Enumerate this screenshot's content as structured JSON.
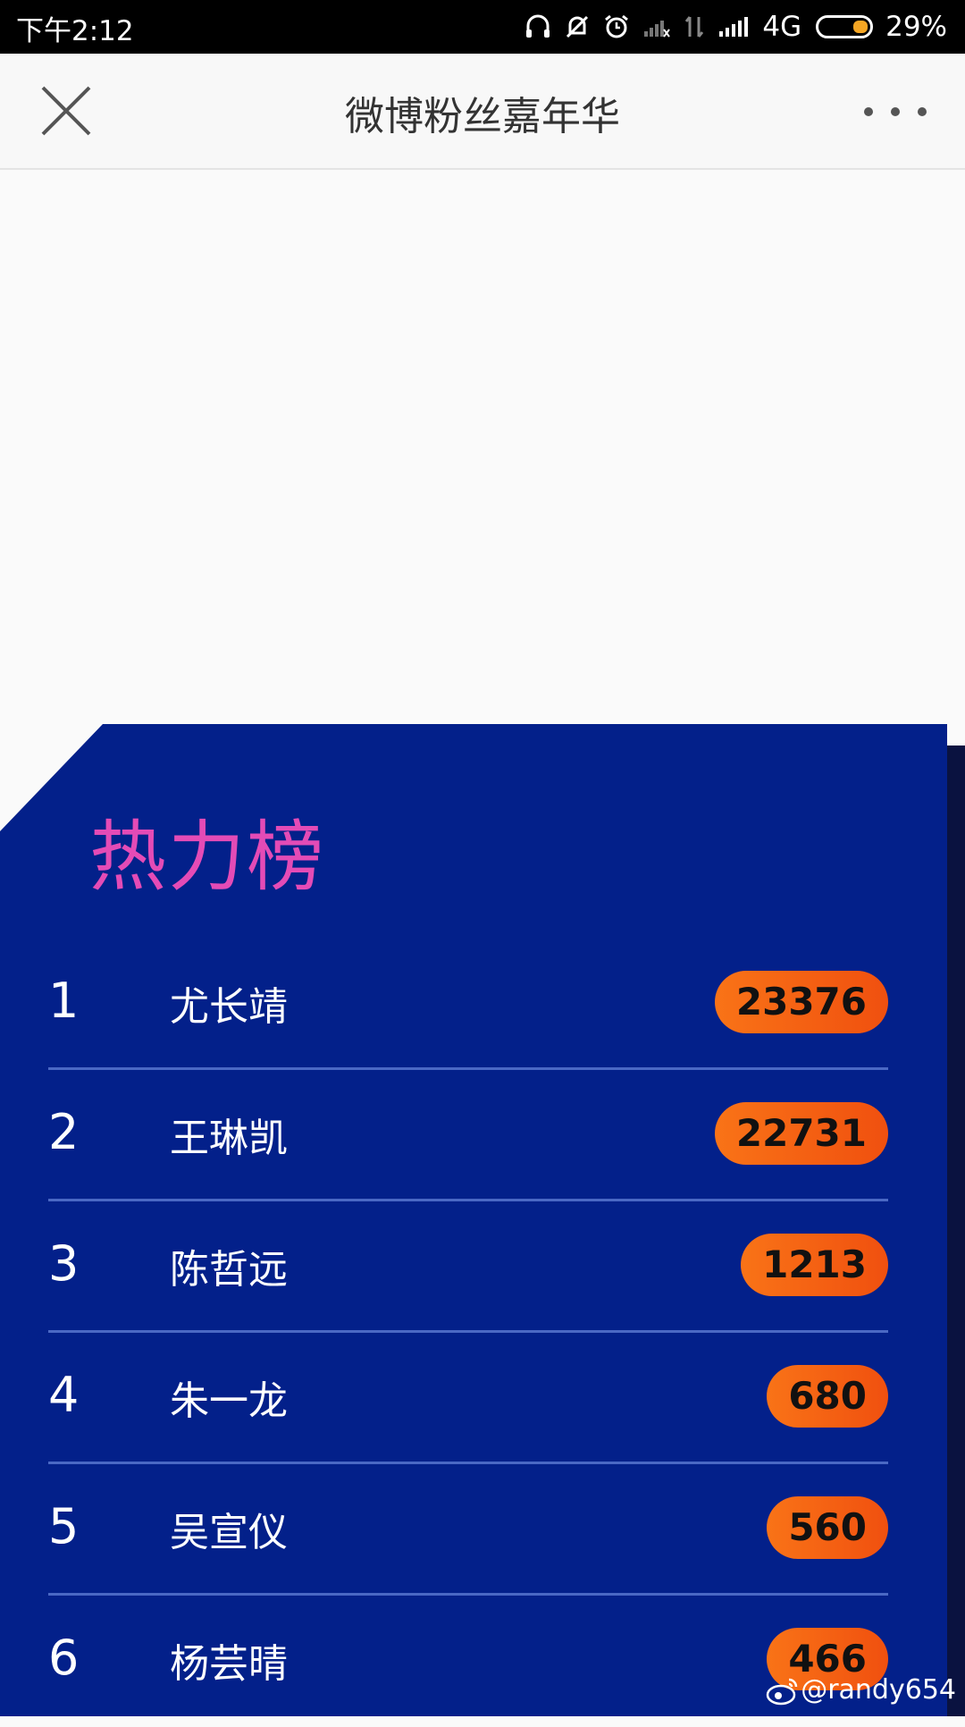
{
  "status_bar": {
    "time": "下午2:12",
    "network": "4G",
    "battery": "29%"
  },
  "header": {
    "title": "微博粉丝嘉年华"
  },
  "ranking": {
    "title": "热力榜",
    "rows": [
      {
        "rank": "1",
        "name": "尤长靖",
        "score": "23376"
      },
      {
        "rank": "2",
        "name": "王琳凯",
        "score": "22731"
      },
      {
        "rank": "3",
        "name": "陈哲远",
        "score": "1213"
      },
      {
        "rank": "4",
        "name": "朱一龙",
        "score": "680"
      },
      {
        "rank": "5",
        "name": "吴宣仪",
        "score": "560"
      },
      {
        "rank": "6",
        "name": "杨芸晴",
        "score": "466"
      }
    ]
  },
  "watermark": "@randy654",
  "colors": {
    "panel": "#03208a",
    "title_accent": "#e44bb6",
    "pill": "#f97317"
  }
}
